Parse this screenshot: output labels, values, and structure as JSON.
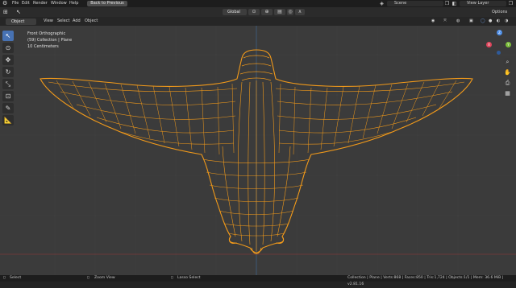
{
  "menu": {
    "items": [
      "File",
      "Edit",
      "Render",
      "Window",
      "Help"
    ],
    "back_label": "Back to Previous",
    "scene": "Scene",
    "view_layer": "View Layer"
  },
  "tool_settings": {
    "mode": "Object Mode",
    "orientation": "Global",
    "options": "Options",
    "menus": [
      "View",
      "Select",
      "Add",
      "Object"
    ]
  },
  "viewport": {
    "view_name": "Front Orthographic",
    "collection": "(59) Collection | Plane",
    "scale": "10 Centimeters"
  },
  "gizmo": {
    "x": "X",
    "y": "Y",
    "z": "Z",
    "x_color": "#e0455c",
    "y_color": "#7bbd3a",
    "z_color": "#4f8fe8"
  },
  "status": {
    "select": "Select",
    "zoom": "Zoom View",
    "lasso": "Lasso Select",
    "stats": "Collection | Plane | Verts:868 | Faces:850 | Tris:1,724 | Objects:1/1 | Mem: 36.6 MiB | v2.81.16"
  },
  "colors": {
    "wire": "#f29a1a",
    "accent": "#4772b3"
  }
}
